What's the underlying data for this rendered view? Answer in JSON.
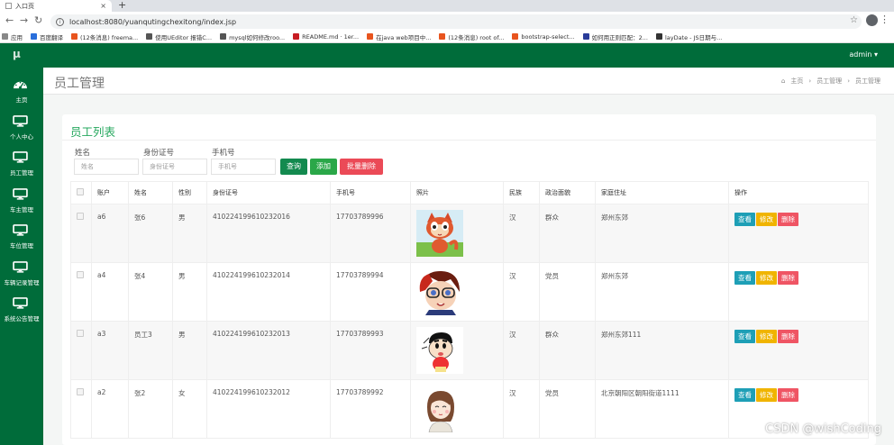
{
  "browser": {
    "tab_title": "入口页",
    "tab_close": "×",
    "new_tab": "+",
    "url": "localhost:8080/yuanqutingchexitong/index.jsp",
    "bookmarks": [
      {
        "label": "应用",
        "color": "#888888"
      },
      {
        "label": "百度翻译",
        "color": "#2a6fdb"
      },
      {
        "label": "(12条消息) freema...",
        "color": "#e8541e"
      },
      {
        "label": "使用UEditor 报错C...",
        "color": "#555555"
      },
      {
        "label": "mysql如何修改roo...",
        "color": "#555555"
      },
      {
        "label": "README.md · 1er...",
        "color": "#c71d23"
      },
      {
        "label": "在java web项目中...",
        "color": "#e8541e"
      },
      {
        "label": "(12条消息) root of...",
        "color": "#e8541e"
      },
      {
        "label": "bootstrap-select...",
        "color": "#e8541e"
      },
      {
        "label": "如何用正则匹配：2...",
        "color": "#2a3c9a"
      },
      {
        "label": "layDate - JS日期与...",
        "color": "#333333"
      }
    ]
  },
  "header": {
    "logo": "μ",
    "user_menu": "admin ▾"
  },
  "sidebar": {
    "items": [
      {
        "label": "主页",
        "icon": "dashboard-icon"
      },
      {
        "label": "个人中心",
        "icon": "monitor-icon"
      },
      {
        "label": "员工管理",
        "icon": "monitor-icon"
      },
      {
        "label": "车主管理",
        "icon": "monitor-icon"
      },
      {
        "label": "车位管理",
        "icon": "monitor-icon"
      },
      {
        "label": "车辆记录管理",
        "icon": "monitor-icon"
      },
      {
        "label": "系统公告管理",
        "icon": "monitor-icon"
      }
    ]
  },
  "page": {
    "title": "员工管理",
    "breadcrumb": [
      "主页",
      "员工管理",
      "员工管理"
    ],
    "breadcrumb_sep": "›"
  },
  "list": {
    "title": "员工列表",
    "filters": {
      "name_label": "姓名",
      "name_placeholder": "姓名",
      "idcard_label": "身份证号",
      "idcard_placeholder": "身份证号",
      "phone_label": "手机号",
      "phone_placeholder": "手机号"
    },
    "buttons": {
      "query": "查询",
      "add": "添加",
      "batch_delete": "批量删除"
    },
    "columns": [
      "账户",
      "姓名",
      "性别",
      "身份证号",
      "手机号",
      "照片",
      "民族",
      "政治面貌",
      "家庭住址",
      "操作"
    ],
    "row_actions": {
      "view": "查看",
      "edit": "修改",
      "delete": "删除"
    },
    "rows": [
      {
        "account": "a6",
        "name": "张6",
        "gender": "男",
        "idcard": "410224199610232016",
        "phone": "17703789996",
        "photo": "cartoon-fox-photo",
        "ethnicity": "汉",
        "political": "群众",
        "address": "郑州东郊"
      },
      {
        "account": "a4",
        "name": "张4",
        "gender": "男",
        "idcard": "410224199610232014",
        "phone": "17703789994",
        "photo": "cartoon-boy-photo",
        "ethnicity": "汉",
        "political": "党员",
        "address": "郑州东郊"
      },
      {
        "account": "a3",
        "name": "员工3",
        "gender": "男",
        "idcard": "410224199610232013",
        "phone": "17703789993",
        "photo": "crayon-kid-photo",
        "ethnicity": "汉",
        "political": "群众",
        "address": "郑州东郊111"
      },
      {
        "account": "a2",
        "name": "张2",
        "gender": "女",
        "idcard": "410224199610232012",
        "phone": "17703789992",
        "photo": "sketch-girl-photo",
        "ethnicity": "汉",
        "political": "党员",
        "address": "北京朝阳区朝阳街道1111"
      }
    ]
  },
  "watermark": "CSDN @wishCoding",
  "colors": {
    "brand": "#006c3a",
    "title": "#27a85f",
    "view": "#1e9fb6",
    "edit": "#f0b400",
    "delete": "#ef5564"
  }
}
